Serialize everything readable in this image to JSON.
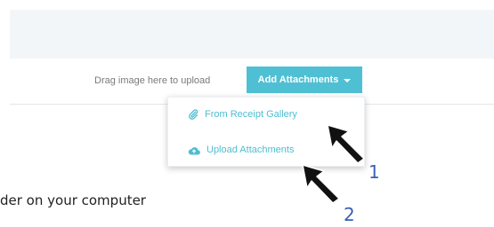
{
  "upload": {
    "drag_hint": "Drag image here to upload",
    "add_button_label": "Add Attachments"
  },
  "menu": {
    "items": [
      {
        "label": "From Receipt Gallery",
        "icon": "paperclip-icon"
      },
      {
        "label": "Upload Attachments",
        "icon": "cloud-upload-icon"
      }
    ]
  },
  "instruction_fragment": "der on your computer",
  "annotations": {
    "step_1": "1",
    "step_2": "2"
  },
  "colors": {
    "accent": "#4fc0d3",
    "menu_text": "#4fbdd0",
    "annotation_number": "#3a5fb5"
  }
}
